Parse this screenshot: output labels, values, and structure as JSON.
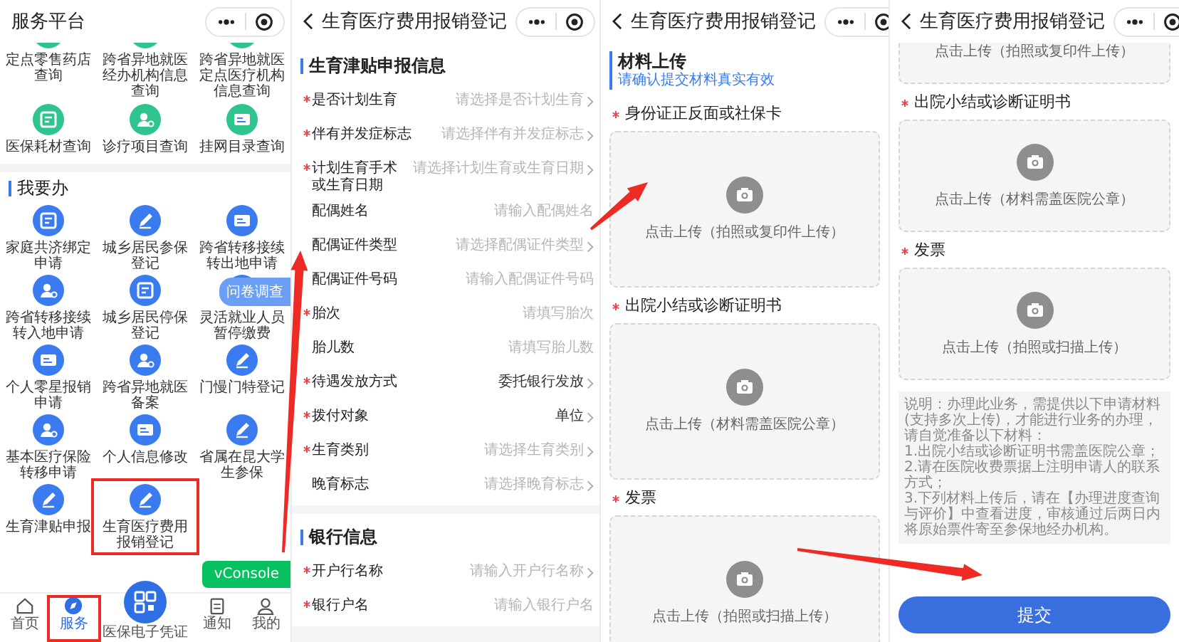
{
  "service_screen": {
    "title": "服务平台",
    "top_items": [
      {
        "label": "定点零售药店查询"
      },
      {
        "label": "跨省异地就医经办机构信息查询"
      },
      {
        "label": "跨省异地就医定点医疗机构信息查询"
      },
      {
        "label": "医保耗材查询"
      },
      {
        "label": "诊疗项目查询"
      },
      {
        "label": "挂网目录查询"
      }
    ],
    "todo": {
      "title": "我要办",
      "items": [
        {
          "label": "家庭共济绑定申请"
        },
        {
          "label": "城乡居民参保登记"
        },
        {
          "label": "跨省转移接续转出地申请"
        },
        {
          "label": "跨省转移接续转入地申请"
        },
        {
          "label": "城乡居民停保登记"
        },
        {
          "label": "灵活就业人员暂停缴费"
        },
        {
          "label": "个人零星报销申请"
        },
        {
          "label": "跨省异地就医备案"
        },
        {
          "label": "门慢门特登记"
        },
        {
          "label": "基本医疗保险转移申请"
        },
        {
          "label": "个人信息修改"
        },
        {
          "label": "省属在昆大学生参保"
        },
        {
          "label": "生育津贴申报"
        },
        {
          "label": "生育医疗费用报销登记"
        }
      ]
    },
    "survey_button": "问卷调查",
    "debug_button": "vConsole",
    "tab_bar": [
      {
        "label": "首页",
        "kind": "tab",
        "selected": false
      },
      {
        "label": "服务",
        "kind": "tab",
        "selected": true
      },
      {
        "label": "医保电子凭证",
        "kind": "center",
        "selected": false
      },
      {
        "label": "通知",
        "kind": "tab",
        "selected": false
      },
      {
        "label": "我的",
        "kind": "tab",
        "selected": false
      }
    ]
  },
  "form_screen": {
    "title": "生育医疗费用报销登记",
    "sections": [
      {
        "title": "生育津贴申报信息",
        "fields": [
          {
            "label": "是否计划生育",
            "required": true,
            "kind": "select",
            "placeholder": "请选择是否计划生育"
          },
          {
            "label": "伴有并发症标志",
            "required": true,
            "kind": "select",
            "placeholder": "请选择伴有并发症标志"
          },
          {
            "label": "计划生育手术或生育日期",
            "required": true,
            "kind": "select",
            "placeholder": "请选择计划生育或生育日期"
          },
          {
            "label": "配偶姓名",
            "required": false,
            "kind": "input",
            "placeholder": "请输入配偶姓名"
          },
          {
            "label": "配偶证件类型",
            "required": false,
            "kind": "select",
            "placeholder": "请选择配偶证件类型"
          },
          {
            "label": "配偶证件号码",
            "required": false,
            "kind": "input",
            "placeholder": "请输入配偶证件号码"
          },
          {
            "label": "胎次",
            "required": true,
            "kind": "input",
            "placeholder": "请填写胎次"
          },
          {
            "label": "胎儿数",
            "required": false,
            "kind": "input",
            "placeholder": "请填写胎儿数"
          },
          {
            "label": "待遇发放方式",
            "required": true,
            "kind": "select",
            "value": "委托银行发放"
          },
          {
            "label": "拨付对象",
            "required": true,
            "kind": "select",
            "value": "单位"
          },
          {
            "label": "生育类别",
            "required": true,
            "kind": "select",
            "placeholder": "请选择生育类别"
          },
          {
            "label": "晚育标志",
            "required": false,
            "kind": "select",
            "placeholder": "请选择晚育标志"
          }
        ]
      },
      {
        "title": "银行信息",
        "fields": [
          {
            "label": "开户行名称",
            "required": true,
            "kind": "select",
            "placeholder": "请输入开户行名称"
          },
          {
            "label": "银行户名",
            "required": true,
            "kind": "input",
            "placeholder": "请输入银行户名"
          }
        ]
      }
    ]
  },
  "upload_screen": {
    "title": "生育医疗费用报销登记",
    "section_title": "材料上传",
    "section_hint": "请确认提交材料真实有效",
    "uploads": [
      {
        "label": "身份证正反面或社保卡",
        "required": true,
        "hint": "点击上传（拍照或复印件上传）"
      },
      {
        "label": "出院小结或诊断证明书",
        "required": true,
        "hint": "点击上传（材料需盖医院公章）"
      },
      {
        "label": "发票",
        "required": true,
        "hint": "点击上传（拍照或扫描上传）"
      }
    ]
  },
  "upload_screen_scrolled": {
    "title": "生育医疗费用报销登记",
    "uploads": [
      {
        "hint": "点击上传（拍照或复印件上传）"
      },
      {
        "label": "出院小结或诊断证明书",
        "required": true,
        "hint": "点击上传（材料需盖医院公章）"
      },
      {
        "label": "发票",
        "required": true,
        "hint": "点击上传（拍照或扫描上传）"
      }
    ],
    "notes": "说明：办理此业务，需提供以下申请材料(支持多次上传)，才能进行业务的办理，请自觉准备以下材料：\n1.出院小结或诊断证明书需盖医院公章；\n2.请在医院收费票据上注明申请人的联系方式；\n3.下列材料上传后，请在【办理进度查询与评价】中查看进度，审核通过后两日内将原始票件寄至参保地经办机构。",
    "submit": "提交"
  }
}
